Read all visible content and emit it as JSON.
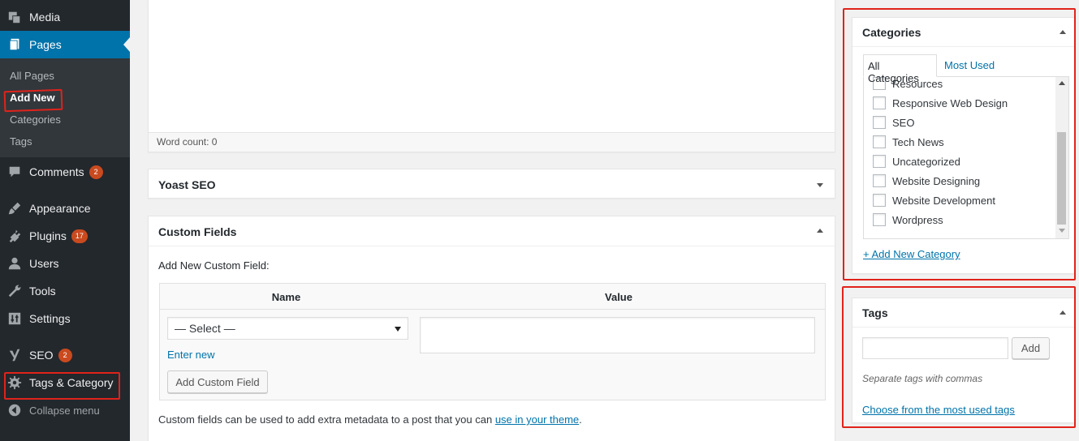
{
  "sidebar": {
    "items": [
      {
        "label": "Media",
        "icon": "media-icon"
      },
      {
        "label": "Pages",
        "icon": "pages-icon"
      },
      {
        "label": "Comments",
        "icon": "comments-icon",
        "badge": "2"
      },
      {
        "label": "Appearance",
        "icon": "appearance-brush-icon"
      },
      {
        "label": "Plugins",
        "icon": "plugins-icon",
        "badge": "17"
      },
      {
        "label": "Users",
        "icon": "users-icon"
      },
      {
        "label": "Tools",
        "icon": "tools-wrench-icon"
      },
      {
        "label": "Settings",
        "icon": "settings-icon"
      },
      {
        "label": "SEO",
        "icon": "yoast-seo-icon",
        "badge": "2"
      },
      {
        "label": "Tags & Category",
        "icon": "gear-icon"
      }
    ],
    "submenu": [
      "All Pages",
      "Add New",
      "Categories",
      "Tags"
    ],
    "collapse_label": "Collapse menu",
    "active_color": "#0073aa"
  },
  "editor": {
    "word_count": "Word count: 0"
  },
  "yoast": {
    "title": "Yoast SEO"
  },
  "custom_fields": {
    "title": "Custom Fields",
    "subtitle": "Add New Custom Field:",
    "col_name": "Name",
    "col_value": "Value",
    "select_value": "— Select —",
    "enter_new": "Enter new",
    "add_button": "Add Custom Field",
    "note_text": "Custom fields can be used to add extra metadata to a post that you can",
    "note_link": "use in your theme",
    "note_end": "."
  },
  "categories": {
    "title": "Categories",
    "tab_all": "All Categories",
    "tab_most_used": "Most Used",
    "items": [
      "Resources",
      "Responsive Web Design",
      "SEO",
      "Tech News",
      "Uncategorized",
      "Website Designing",
      "Website Development",
      "Wordpress"
    ],
    "add_new": "+ Add New Category"
  },
  "tags": {
    "title": "Tags",
    "add_button": "Add",
    "hint": "Separate tags with commas",
    "choose_link": "Choose from the most used tags"
  },
  "annotation_color": "#e0231b"
}
